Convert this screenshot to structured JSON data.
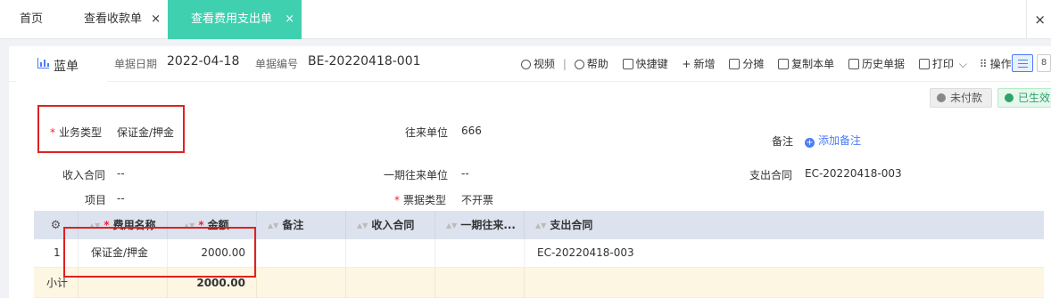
{
  "tabs": {
    "home": "首页",
    "view_receipt": "查看收款单",
    "view_expense": "查看费用支出单",
    "close_glyph": "×"
  },
  "header": {
    "doc_tab": "蓝单",
    "date_label": "单据日期",
    "date_value": "2022-04-18",
    "no_label": "单据编号",
    "no_value": "BE-20220418-001",
    "toolbar": {
      "video": "视频",
      "help": "帮助",
      "shortcut": "快捷键",
      "add": "新增",
      "split": "分摊",
      "copy": "复制本单",
      "history": "历史单据",
      "print": "打印",
      "operate": "操作"
    }
  },
  "status": {
    "unpaid": "未付款",
    "effective": "已生效"
  },
  "form": {
    "business_type_label": "业务类型",
    "business_type_value": "保证金/押金",
    "partner_label": "往来单位",
    "partner_value": "666",
    "remark_label": "备注",
    "add_remark": "添加备注",
    "income_contract_label": "收入合同",
    "income_contract_value": "--",
    "phase1_partner_label": "一期往来单位",
    "phase1_partner_value": "--",
    "expense_contract_label": "支出合同",
    "expense_contract_value": "EC-20220418-003",
    "project_label": "项目",
    "project_value": "--",
    "invoice_type_label": "票据类型",
    "invoice_type_value": "不开票"
  },
  "table": {
    "columns": [
      "费用名称",
      "金额",
      "备注",
      "收入合同",
      "一期往来...",
      "支出合同"
    ],
    "rows": [
      {
        "index": "1",
        "name": "保证金/押金",
        "amount": "2000.00",
        "remark": "",
        "income_contract": "",
        "phase1": "",
        "expense_contract": "EC-20220418-003"
      }
    ],
    "subtotal_label": "小计",
    "subtotal_amount": "2000.00"
  },
  "colors": {
    "accent": "#3fd0b0",
    "link": "#4a7cf7",
    "required": "#f5222d",
    "annotation": "#e02020"
  }
}
